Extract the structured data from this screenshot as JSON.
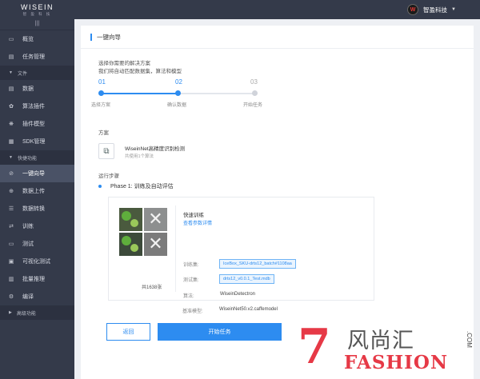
{
  "brand": {
    "name": "WISEIN",
    "sub": "智 盈 科 技"
  },
  "user": {
    "avatar": "W",
    "name": "智盈科技"
  },
  "sidebar": {
    "collapse": "|||",
    "items": [
      {
        "icon": "▭",
        "label": "概览"
      },
      {
        "icon": "▤",
        "label": "任务管理"
      }
    ],
    "group_file": "文件",
    "file_items": [
      {
        "icon": "▤",
        "label": "数据"
      },
      {
        "icon": "✿",
        "label": "算法插件"
      },
      {
        "icon": "❋",
        "label": "插件模型"
      },
      {
        "icon": "▦",
        "label": "SDK管理"
      }
    ],
    "group_quick": "快捷功能",
    "quick_items": [
      {
        "icon": "⊘",
        "label": "一键向导"
      },
      {
        "icon": "⊕",
        "label": "数据上传"
      },
      {
        "icon": "☰",
        "label": "数据转换"
      },
      {
        "icon": "⇄",
        "label": "训练"
      },
      {
        "icon": "▭",
        "label": "测试"
      },
      {
        "icon": "▣",
        "label": "可视化测试"
      },
      {
        "icon": "▥",
        "label": "批量推理"
      },
      {
        "icon": "⚙",
        "label": "编译"
      }
    ],
    "group_advanced": "高级功能"
  },
  "main": {
    "title": "一键向导",
    "hint1": "选择你需要的解决方案",
    "hint2": "我们将自动匹配数据集，算法和模型",
    "steps": [
      {
        "num": "01",
        "label": "选择方案"
      },
      {
        "num": "02",
        "label": "确认数据"
      },
      {
        "num": "03",
        "label": "开始任务"
      }
    ],
    "scheme_label": "方案",
    "scheme": {
      "name": "WiseinNet高精度识别检测",
      "sub": "共使用1个算法"
    },
    "run_steps_label": "运行步骤",
    "phase": "Phase 1: 训练及自动评估",
    "card": {
      "img_count": "共1638张",
      "fast_train": "快速训练",
      "view_params": "查看参数详情",
      "train_set_label": "训练集:",
      "train_set": "IceBox_SKU-drts12_batch#1108aa",
      "test_set_label": "测试集:",
      "test_set": "drts12_v0.0.1_Test.mdb",
      "algo_label": "算法:",
      "algo": "WiseinDetectron",
      "model_label": "基准模型:",
      "model": "WiseinNet50.v2.caffemodel"
    },
    "btn_back": "返回",
    "btn_start": "开始任务"
  },
  "watermark": {
    "digit": "7",
    "cn": "风尚汇",
    "en": "FASHION",
    "com": ".COM"
  },
  "colors": {
    "accent": "#2d8cf0",
    "sidebar": "#343a4a",
    "watermark_red": "#e63946"
  }
}
